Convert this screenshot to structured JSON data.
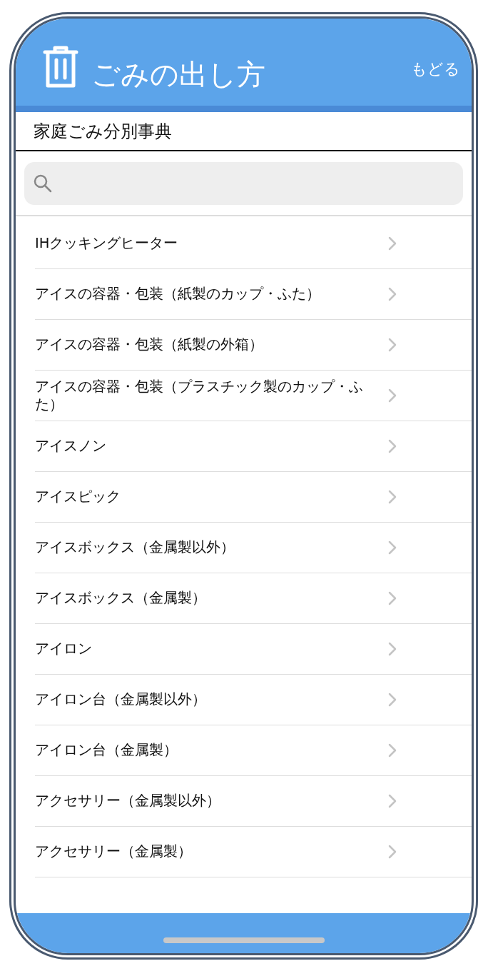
{
  "header": {
    "title": "ごみの出し方",
    "back": "もどる"
  },
  "subtitle": "家庭ごみ分別事典",
  "items": [
    {
      "label": "IHクッキングヒーター"
    },
    {
      "label": "アイスの容器・包装（紙製のカップ・ふた）"
    },
    {
      "label": "アイスの容器・包装（紙製の外箱）"
    },
    {
      "label": "アイスの容器・包装（プラスチック製のカップ・ふた）"
    },
    {
      "label": "アイスノン"
    },
    {
      "label": "アイスピック"
    },
    {
      "label": "アイスボックス（金属製以外）"
    },
    {
      "label": "アイスボックス（金属製）"
    },
    {
      "label": "アイロン"
    },
    {
      "label": "アイロン台（金属製以外）"
    },
    {
      "label": "アイロン台（金属製）"
    },
    {
      "label": "アクセサリー（金属製以外）"
    },
    {
      "label": "アクセサリー（金属製）"
    }
  ]
}
